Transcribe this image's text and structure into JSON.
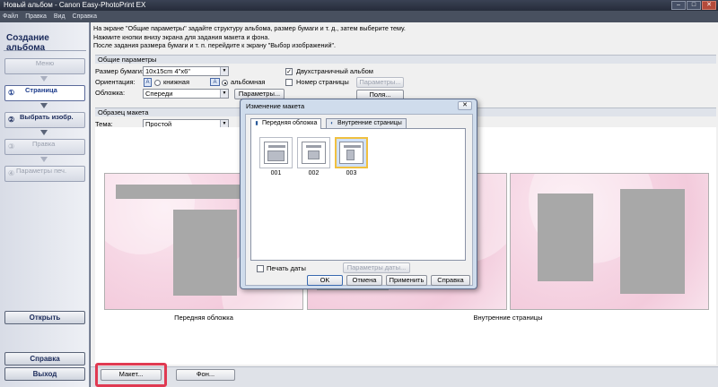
{
  "window": {
    "title": "Новый альбом - Canon Easy-PhotoPrint EX"
  },
  "menu": [
    "Файл",
    "Правка",
    "Вид",
    "Справка"
  ],
  "sidebar": {
    "title": "Создание альбома",
    "steps": [
      {
        "num": "",
        "label": "Меню",
        "state": "disabled"
      },
      {
        "num": "①",
        "label": "Страница",
        "state": "active"
      },
      {
        "num": "②",
        "label": "Выбрать изобр.",
        "state": "enabled"
      },
      {
        "num": "③",
        "label": "Правка",
        "state": "disabled"
      },
      {
        "num": "④",
        "label": "Параметры печ.",
        "state": "disabled"
      }
    ],
    "open_label": "Открыть",
    "help_label": "Справка",
    "exit_label": "Выход"
  },
  "instructions": [
    "На экране \"Общие параметры\" задайте структуру альбома, размер бумаги и т. д., затем выберите тему.",
    "Нажмите кнопки внизу экрана для задания макета и фона.",
    "После задания размера бумаги и т. п. перейдите к экрану \"Выбор изображений\"."
  ],
  "general": {
    "section_title": "Общие параметры",
    "paper_size_label": "Размер бумаги:",
    "paper_size_value": "10x15cm 4\"x6\"",
    "orientation_label": "Ориентация:",
    "portrait_label": "книжная",
    "landscape_label": "альбомная",
    "cover_label": "Обложка:",
    "cover_value": "Спереди",
    "params_button": "Параметры...",
    "double_sided_label": "Двухстраничный альбом",
    "page_number_label": "Номер страницы",
    "page_params_button": "Параметры...",
    "margins_button": "Поля..."
  },
  "sample": {
    "section_title": "Образец макета",
    "theme_label": "Тема:",
    "theme_value": "Простой",
    "front_caption": "Передняя обложка",
    "inner_caption": "Внутренние страницы"
  },
  "bottom": {
    "layout_button": "Макет...",
    "background_button": "Фон..."
  },
  "dialog": {
    "title": "Изменение макета",
    "tabs": [
      "Передняя обложка",
      "Внутренние страницы"
    ],
    "layouts": [
      "001",
      "002",
      "003"
    ],
    "selected_layout": "003",
    "print_date_label": "Печать даты",
    "date_params_button": "Параметры даты...",
    "ok": "OK",
    "cancel": "Отмена",
    "apply": "Применить",
    "help": "Справка"
  },
  "colors": {
    "highlight": "#e03a52",
    "selected_thumb": "#f0c040"
  }
}
